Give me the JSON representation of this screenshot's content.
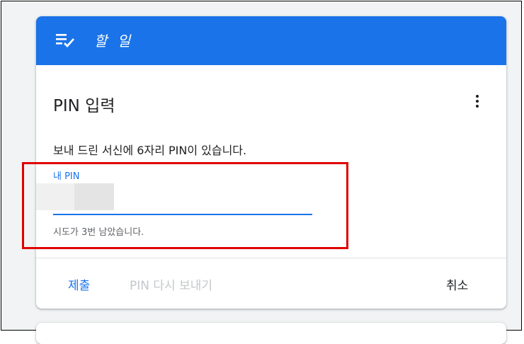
{
  "header": {
    "title": "할 일",
    "icon": "tasks-checklist-icon",
    "color": "#1a73e8"
  },
  "pin_card": {
    "title": "PIN 입력",
    "menu_icon": "more-vert-icon",
    "description": "보내 드린 서신에 6자리 PIN이 있습니다.",
    "field": {
      "label": "내 PIN",
      "value": "",
      "helper_text": "시도가 3번 남았습니다."
    }
  },
  "actions": {
    "submit": "제출",
    "resend": "PIN 다시 보내기",
    "cancel": "취소"
  },
  "colors": {
    "accent": "#1a73e8",
    "disabled": "#c4c7ca",
    "annotation": "#e10000"
  }
}
